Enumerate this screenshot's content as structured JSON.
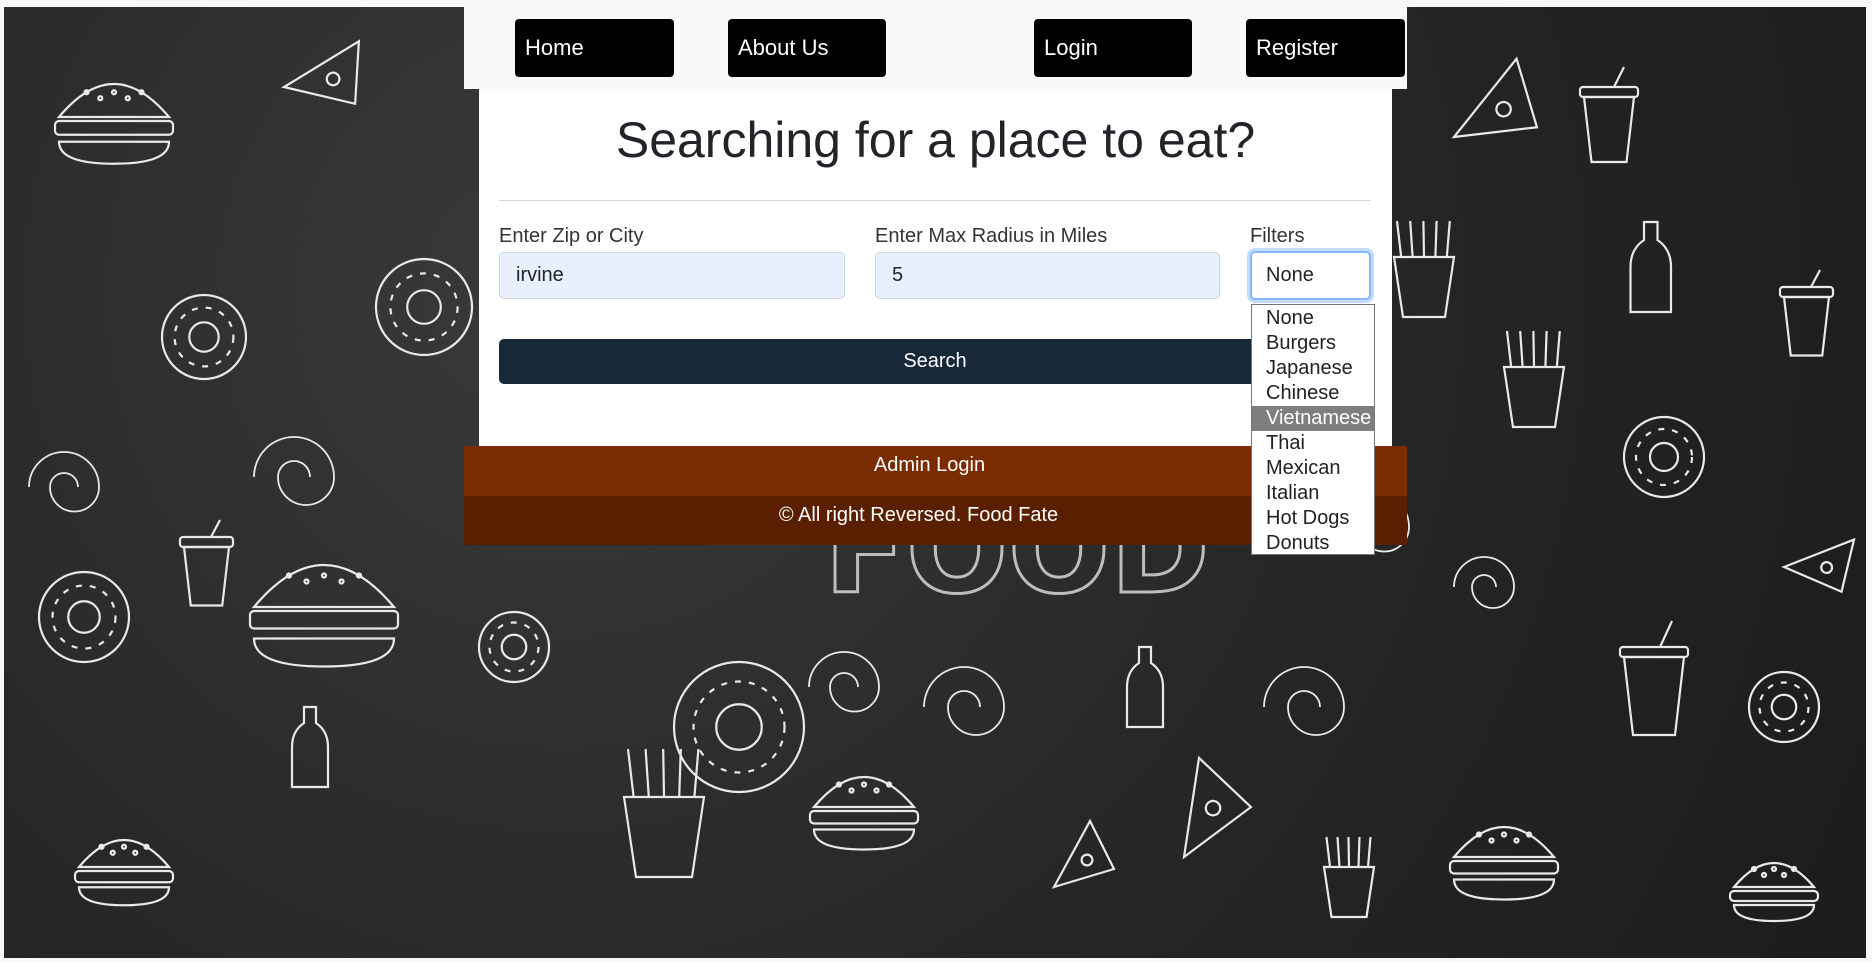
{
  "navbar": {
    "items": [
      {
        "label": "Home"
      },
      {
        "label": "About Us"
      },
      {
        "label": "Login"
      },
      {
        "label": "Register"
      }
    ]
  },
  "search_card": {
    "title": "Searching for a place to eat?",
    "location": {
      "label": "Enter Zip or City",
      "value": "irvine"
    },
    "radius": {
      "label": "Enter Max Radius in Miles",
      "value": "5"
    },
    "filters": {
      "label": "Filters",
      "selected": "None"
    },
    "search_button": "Search"
  },
  "filter_dropdown": {
    "options": [
      "None",
      "Burgers",
      "Japanese",
      "Chinese",
      "Vietnamese",
      "Thai",
      "Mexican",
      "Italian",
      "Hot Dogs",
      "Donuts"
    ],
    "highlighted": "Vietnamese"
  },
  "footer": {
    "admin_link": "Admin Login",
    "copyright": "© All right Reversed. Food Fate"
  },
  "colors": {
    "nav_button": "#000000",
    "search_button": "#172839",
    "admin_bar": "#7a2b00",
    "copyright_bar": "#5a1f00",
    "input_background": "#e8f0fe"
  },
  "background": {
    "watermark_text": "FOOD"
  }
}
